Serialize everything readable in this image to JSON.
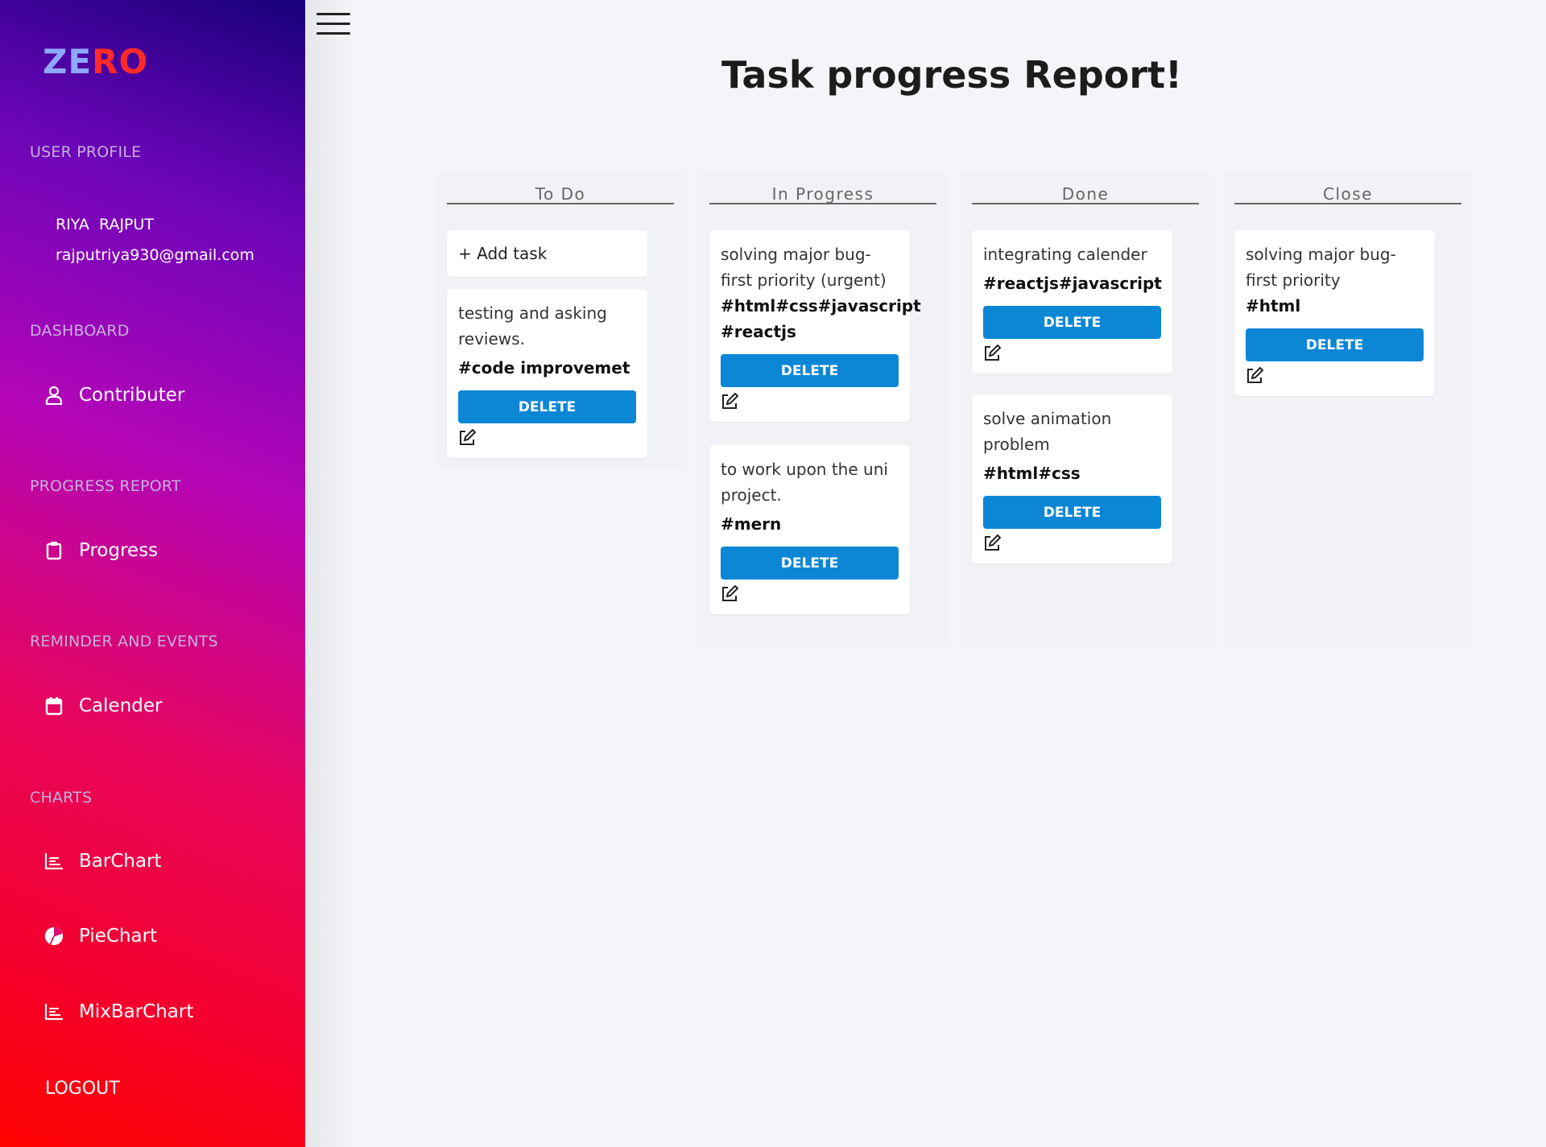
{
  "brand": {
    "part1": "ZE",
    "part2": "RO"
  },
  "sidebar": {
    "user_profile_label": "USER PROFILE",
    "user_name": "RIYA  RAJPUT",
    "user_email": "rajputriya930@gmail.com",
    "dashboard_label": "DASHBOARD",
    "contributer": "Contributer",
    "progress_report_label": "PROGRESS REPORT",
    "progress": "Progress",
    "reminder_label": "REMINDER AND EVENTS",
    "calender": "Calender",
    "charts_label": "CHARTS",
    "barchart": "BarChart",
    "piechart": "PieChart",
    "mixbarchart": "MixBarChart",
    "logout": "LOGOUT"
  },
  "header": {
    "title": "Task progress Report!"
  },
  "board": {
    "columns": [
      {
        "name": "To Do",
        "add_task": "+ Add task",
        "cards": [
          {
            "title": "testing and asking reviews.",
            "tags": "#code improvemet",
            "delete": "DELETE"
          }
        ]
      },
      {
        "name": "In Progress",
        "cards": [
          {
            "title": "solving major bug-first priority (urgent)",
            "tags": "#html#css#javascript #reactjs",
            "delete": "DELETE"
          },
          {
            "title": "to work upon the uni project.",
            "tags": "#mern",
            "delete": "DELETE"
          }
        ]
      },
      {
        "name": "Done",
        "cards": [
          {
            "title": "integrating calender",
            "tags": "#reactjs#javascript",
            "delete": "DELETE"
          },
          {
            "title": "solve animation problem",
            "tags": "#html#css",
            "delete": "DELETE"
          }
        ]
      },
      {
        "name": "Close",
        "cards": [
          {
            "title": "solving major bug-first priority",
            "tags": "#html",
            "delete": "DELETE"
          }
        ]
      }
    ]
  },
  "colors": {
    "accent": "#0b87d6",
    "logo_ze": "#8fa8ff",
    "logo_ro": "#ff2a2a"
  },
  "icons": [
    "user-icon",
    "clipboard-icon",
    "calendar-icon",
    "bar-chart-icon",
    "pie-chart-icon",
    "edit-icon",
    "hamburger-icon"
  ]
}
